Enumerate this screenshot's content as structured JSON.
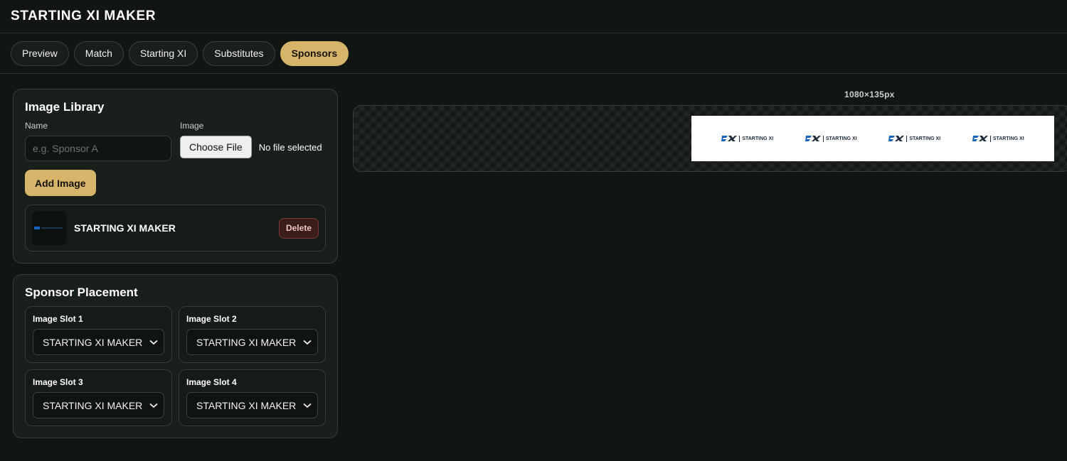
{
  "app": {
    "title": "STARTING XI MAKER"
  },
  "tabs": [
    {
      "label": "Preview",
      "active": false
    },
    {
      "label": "Match",
      "active": false
    },
    {
      "label": "Starting XI",
      "active": false
    },
    {
      "label": "Substitutes",
      "active": false
    },
    {
      "label": "Sponsors",
      "active": true
    }
  ],
  "library": {
    "title": "Image Library",
    "name_label": "Name",
    "name_placeholder": "e.g. Sponsor A",
    "image_label": "Image",
    "choose_file_label": "Choose File",
    "file_status": "No file selected",
    "add_label": "Add Image",
    "items": [
      {
        "name": "STARTING XI MAKER",
        "delete_label": "Delete"
      }
    ]
  },
  "placement": {
    "title": "Sponsor Placement",
    "slots": [
      {
        "label": "Image Slot 1",
        "value": "STARTING XI MAKER"
      },
      {
        "label": "Image Slot 2",
        "value": "STARTING XI MAKER"
      },
      {
        "label": "Image Slot 3",
        "value": "STARTING XI MAKER"
      },
      {
        "label": "Image Slot 4",
        "value": "STARTING XI MAKER"
      }
    ]
  },
  "preview": {
    "size_label": "1080×135px",
    "logo_text": "STARTING XI"
  },
  "colors": {
    "accent": "#d6b46a",
    "background": "#111613",
    "logo_blue": "#1565c0"
  }
}
